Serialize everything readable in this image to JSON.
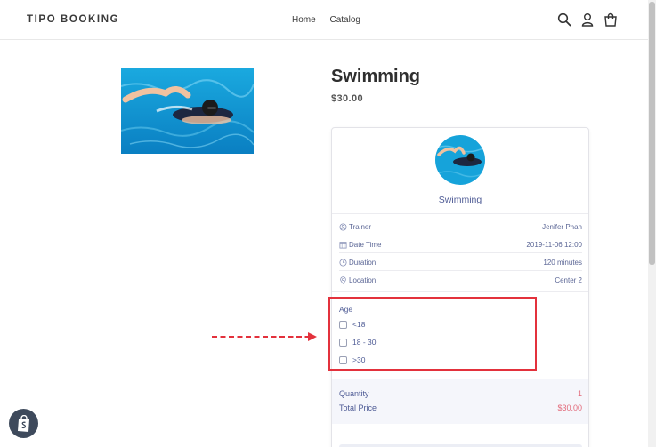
{
  "header": {
    "brand": "TIPO BOOKING",
    "nav": [
      {
        "label": "Home"
      },
      {
        "label": "Catalog"
      }
    ],
    "icons": [
      "search-icon",
      "user-icon",
      "cart-icon"
    ]
  },
  "product": {
    "title": "Swimming",
    "price": "$30.00"
  },
  "booking": {
    "service_name": "Swimming",
    "details": [
      {
        "icon": "trainer-icon",
        "label": "Trainer",
        "value": "Jenifer Phan"
      },
      {
        "icon": "calendar-icon",
        "label": "Date Time",
        "value": "2019-11-06 12:00"
      },
      {
        "icon": "clock-icon",
        "label": "Duration",
        "value": "120 minutes"
      },
      {
        "icon": "location-icon",
        "label": "Location",
        "value": "Center 2"
      }
    ],
    "age": {
      "label": "Age",
      "options": [
        "<18",
        "18 - 30",
        ">30"
      ]
    },
    "quantity_label": "Quantity",
    "quantity_value": "1",
    "total_label": "Total Price",
    "total_value": "$30.00"
  },
  "colors": {
    "accent_text": "#4e5b95",
    "price_pink": "#e26a7a",
    "highlight_red": "#e3313c"
  }
}
